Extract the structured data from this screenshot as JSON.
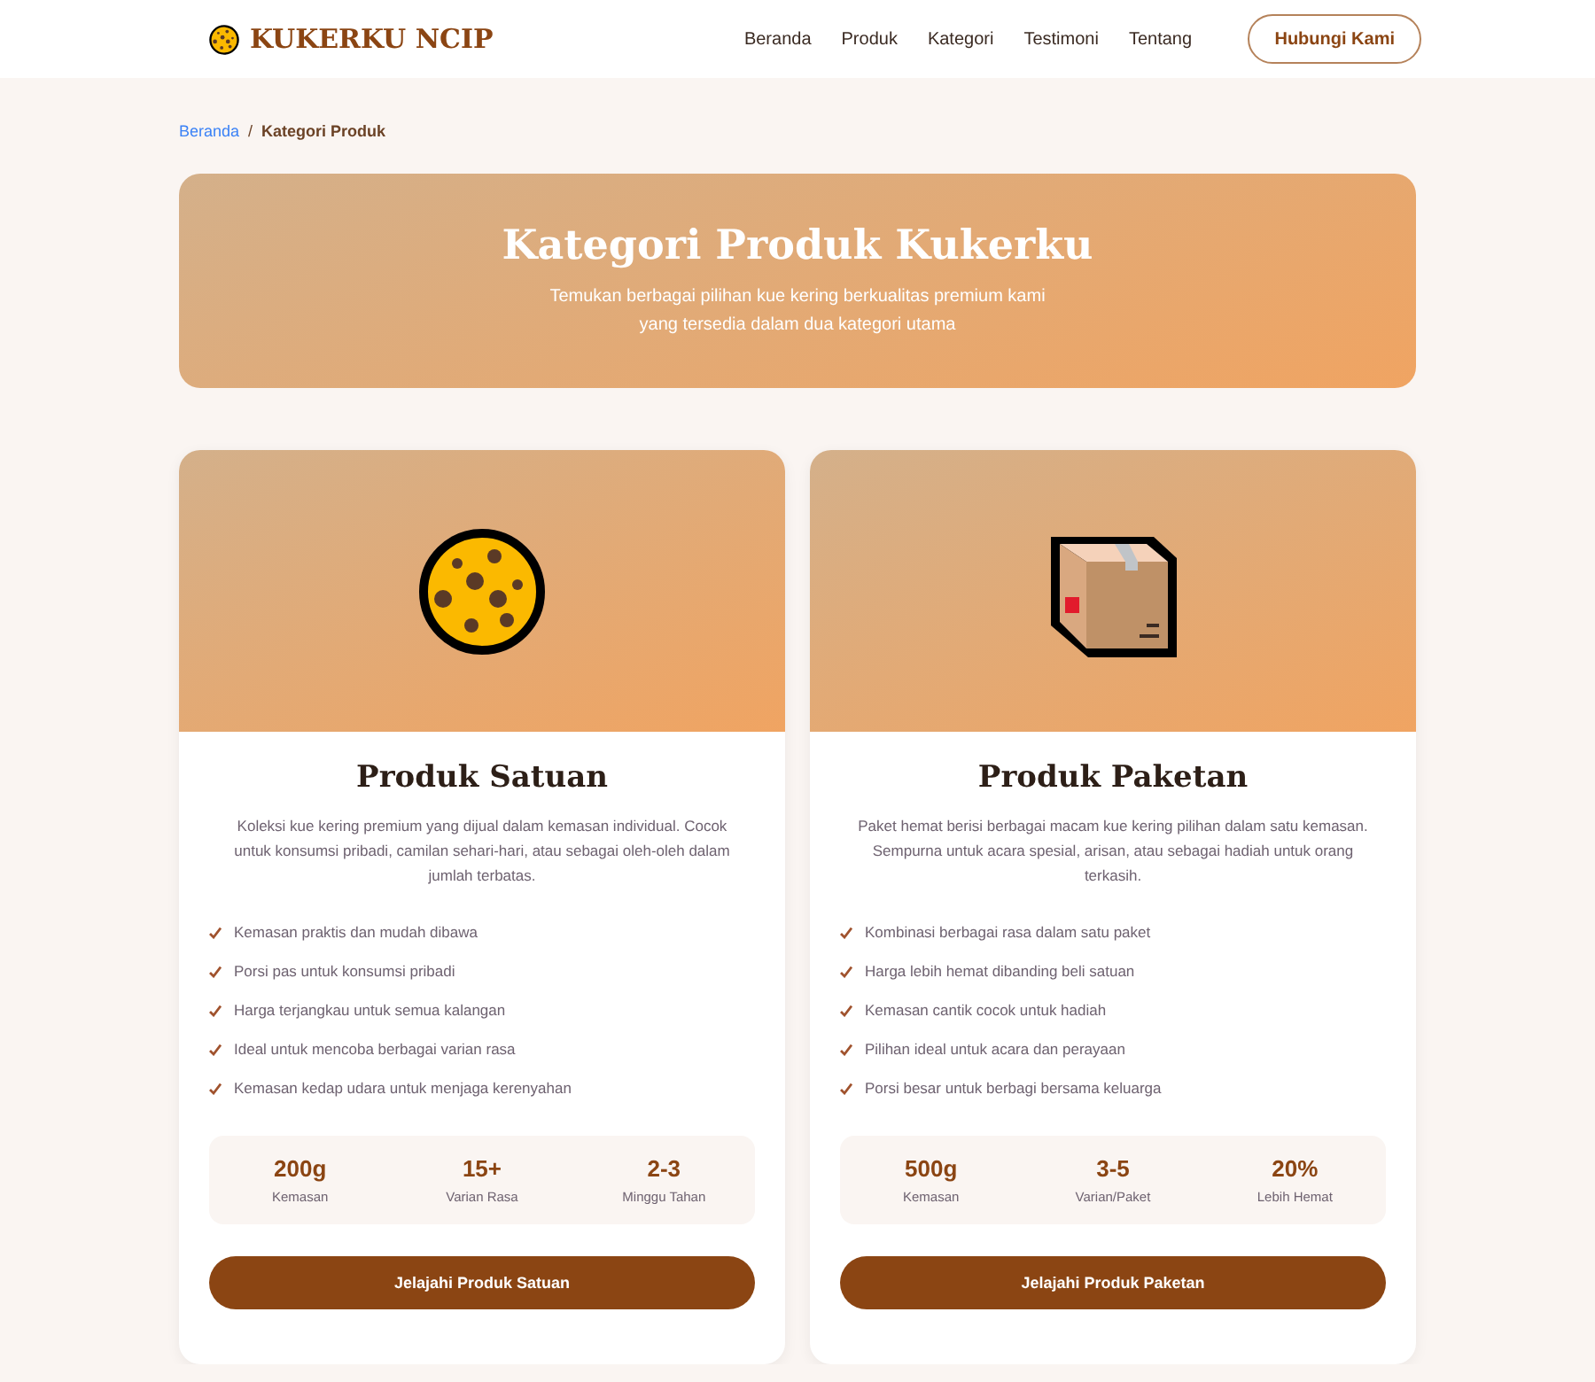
{
  "header": {
    "logo": "KUKERKU NCIP",
    "nav": [
      {
        "label": "Beranda"
      },
      {
        "label": "Produk"
      },
      {
        "label": "Kategori"
      },
      {
        "label": "Testimoni"
      },
      {
        "label": "Tentang"
      }
    ],
    "cta": "Hubungi Kami"
  },
  "breadcrumb": {
    "separator": "/",
    "items": [
      {
        "label": "Beranda",
        "kind": "link"
      },
      {
        "label": "Kategori Produk",
        "kind": "current"
      }
    ]
  },
  "hero": {
    "title": "Kategori Produk Kukerku",
    "subtitle": "Temukan berbagai pilihan kue kering berkualitas premium kami yang tersedia dalam dua kategori utama"
  },
  "categories": [
    {
      "kind": "cookie",
      "title": "Produk Satuan",
      "description": "Koleksi kue kering premium yang dijual dalam kemasan individual. Cocok untuk konsumsi pribadi, camilan sehari-hari, atau sebagai oleh-oleh dalam jumlah terbatas.",
      "features": [
        "Kemasan praktis dan mudah dibawa",
        "Porsi pas untuk konsumsi pribadi",
        "Harga terjangkau untuk semua kalangan",
        "Ideal untuk mencoba berbagai varian rasa",
        "Kemasan kedap udara untuk menjaga kerenyahan"
      ],
      "stats": [
        {
          "value": "200g",
          "label": "Kemasan"
        },
        {
          "value": "15+",
          "label": "Varian Rasa"
        },
        {
          "value": "2-3",
          "label": "Minggu Tahan"
        }
      ],
      "button": "Jelajahi Produk Satuan"
    },
    {
      "kind": "box",
      "title": "Produk Paketan",
      "description": "Paket hemat berisi berbagai macam kue kering pilihan dalam satu kemasan. Sempurna untuk acara spesial, arisan, atau sebagai hadiah untuk orang terkasih.",
      "features": [
        "Kombinasi berbagai rasa dalam satu paket",
        "Harga lebih hemat dibanding beli satuan",
        "Kemasan cantik cocok untuk hadiah",
        "Pilihan ideal untuk acara dan perayaan",
        "Porsi besar untuk berbagi bersama keluarga"
      ],
      "stats": [
        {
          "value": "500g",
          "label": "Kemasan"
        },
        {
          "value": "3-5",
          "label": "Varian/Paket"
        },
        {
          "value": "20%",
          "label": "Lebih Hemat"
        }
      ],
      "button": "Jelajahi Produk Paketan"
    }
  ]
}
